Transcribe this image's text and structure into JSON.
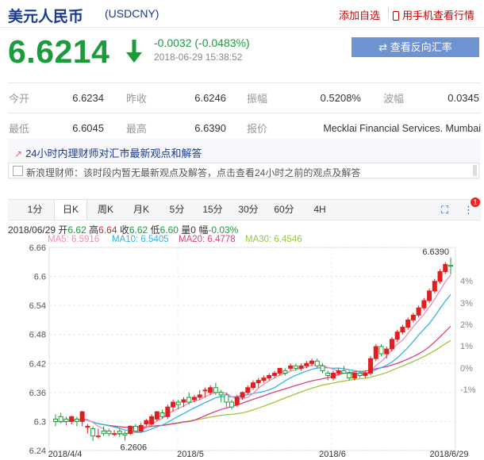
{
  "header": {
    "title": "美元人民币",
    "code": "(USDCNY)",
    "add_watch": "添加自选",
    "mobile": "用手机查看行情"
  },
  "quote": {
    "price": "6.6214",
    "change": "-0.0032 (-0.0483%)",
    "time": "2018-06-29 15:38:52",
    "reverse_button": "查看反向汇率"
  },
  "stats": [
    [
      {
        "label": "今开",
        "value": "6.6234"
      },
      {
        "label": "昨收",
        "value": "6.6246"
      },
      {
        "label": "振幅",
        "value": "0.5208%"
      },
      {
        "label": "波幅",
        "value": "0.0345"
      }
    ],
    [
      {
        "label": "最低",
        "value": "6.6045"
      },
      {
        "label": "最高",
        "value": "6.6390"
      },
      {
        "label": "报价",
        "value": "Mecklai Financial Services. Mumbai"
      }
    ]
  ],
  "news": {
    "heading": "24小时内理财师对汇市最新观点和解答",
    "message": "新浪理财师：该时段内暂无最新观点及解答，点击查看24小时之前的观点及解答"
  },
  "tabs": [
    "1分",
    "日K",
    "周K",
    "月K",
    "5分",
    "15分",
    "30分",
    "60分",
    "4H"
  ],
  "active_tab": "日K",
  "badge": "1",
  "ohlc": {
    "date": "2018/06/29",
    "open_label": "开",
    "open": "6.62",
    "high_label": "高",
    "high": "6.64",
    "close_label": "收",
    "close": "6.62",
    "low_label": "低",
    "low": "6.60",
    "volume_label": "量",
    "volume": "0",
    "amp_label": "幅",
    "amp": "-0.03%"
  },
  "ma_legend": [
    {
      "label": "MA5: 6.5916",
      "color": "#f08cb4"
    },
    {
      "label": "MA10: 6.5405",
      "color": "#32b4e6"
    },
    {
      "label": "MA20: 6.4778",
      "color": "#e0407a"
    },
    {
      "label": "MA30: 6.4546",
      "color": "#9cc83c"
    }
  ],
  "colors": {
    "up": "#e02020",
    "down": "#1a9c3a",
    "accent": "#1a3a8c"
  },
  "chart_data": {
    "type": "candlestick",
    "y_ticks": [
      "6.66",
      "6.6",
      "6.54",
      "6.48",
      "6.42",
      "6.36",
      "6.3",
      "6.24"
    ],
    "pct_ticks": [
      "4%",
      "3%",
      "2%",
      "1%",
      "0%",
      "-1%"
    ],
    "x_labels": [
      "2018/4/4",
      "2018/5",
      "2018/6",
      "2018/6/29"
    ],
    "ylim": [
      6.24,
      6.66
    ],
    "max_label": "6.6390",
    "min_label": "6.2606",
    "candles": [
      [
        6.305,
        6.31,
        6.3,
        6.315,
        6.29
      ],
      [
        6.31,
        6.305,
        6.3,
        6.318,
        6.296
      ],
      [
        6.305,
        6.3,
        6.3,
        6.31,
        6.292
      ],
      [
        6.3,
        6.305,
        6.31,
        6.312,
        6.294
      ],
      [
        6.305,
        6.3,
        6.3,
        6.31,
        6.29
      ],
      [
        6.3,
        6.295,
        6.32,
        6.322,
        6.29
      ],
      [
        6.29,
        6.285,
        6.29,
        6.295,
        6.275
      ],
      [
        6.285,
        6.27,
        6.27,
        6.29,
        6.26
      ],
      [
        6.27,
        6.28,
        6.27,
        6.285,
        6.265
      ],
      [
        6.28,
        6.285,
        6.275,
        6.29,
        6.27
      ],
      [
        6.28,
        6.275,
        6.275,
        6.285,
        6.27
      ],
      [
        6.275,
        6.28,
        6.275,
        6.282,
        6.27
      ],
      [
        6.28,
        6.275,
        6.275,
        6.285,
        6.268
      ],
      [
        6.275,
        6.27,
        6.272,
        6.28,
        6.2606
      ],
      [
        6.275,
        6.28,
        6.29,
        6.292,
        6.272
      ],
      [
        6.29,
        6.282,
        6.28,
        6.295,
        6.278
      ],
      [
        6.28,
        6.29,
        6.292,
        6.298,
        6.277
      ],
      [
        6.295,
        6.3,
        6.302,
        6.305,
        6.29
      ],
      [
        6.295,
        6.3,
        6.31,
        6.315,
        6.29
      ],
      [
        6.305,
        6.31,
        6.32,
        6.322,
        6.3
      ],
      [
        6.318,
        6.32,
        6.31,
        6.325,
        6.305
      ],
      [
        6.31,
        6.325,
        6.33,
        6.335,
        6.305
      ],
      [
        6.33,
        6.34,
        6.34,
        6.345,
        6.32
      ],
      [
        6.34,
        6.335,
        6.335,
        6.345,
        6.325
      ],
      [
        6.34,
        6.345,
        6.345,
        6.35,
        6.33
      ],
      [
        6.35,
        6.345,
        6.34,
        6.36,
        6.335
      ],
      [
        6.345,
        6.35,
        6.35,
        6.355,
        6.34
      ],
      [
        6.35,
        6.36,
        6.355,
        6.365,
        6.345
      ],
      [
        6.365,
        6.36,
        6.365,
        6.37,
        6.35
      ],
      [
        6.36,
        6.37,
        6.37,
        6.375,
        6.355
      ],
      [
        6.37,
        6.365,
        6.36,
        6.38,
        6.355
      ],
      [
        6.36,
        6.35,
        6.355,
        6.365,
        6.34
      ],
      [
        6.355,
        6.34,
        6.34,
        6.36,
        6.33
      ],
      [
        6.34,
        6.335,
        6.33,
        6.345,
        6.325
      ],
      [
        6.335,
        6.345,
        6.35,
        6.355,
        6.33
      ],
      [
        6.35,
        6.355,
        6.36,
        6.362,
        6.345
      ],
      [
        6.36,
        6.37,
        6.37,
        6.375,
        6.355
      ],
      [
        6.37,
        6.375,
        6.38,
        6.385,
        6.365
      ],
      [
        6.38,
        6.385,
        6.385,
        6.39,
        6.37
      ],
      [
        6.385,
        6.39,
        6.39,
        6.395,
        6.38
      ],
      [
        6.39,
        6.395,
        6.395,
        6.4,
        6.385
      ],
      [
        6.395,
        6.4,
        6.4,
        6.405,
        6.39
      ],
      [
        6.4,
        6.405,
        6.41,
        6.41,
        6.395
      ],
      [
        6.405,
        6.4,
        6.4,
        6.41,
        6.395
      ],
      [
        6.41,
        6.415,
        6.415,
        6.42,
        6.405
      ],
      [
        6.415,
        6.42,
        6.41,
        6.42,
        6.405
      ],
      [
        6.41,
        6.415,
        6.415,
        6.42,
        6.405
      ],
      [
        6.415,
        6.42,
        6.42,
        6.425,
        6.41
      ],
      [
        6.42,
        6.425,
        6.425,
        6.43,
        6.415
      ],
      [
        6.425,
        6.42,
        6.415,
        6.43,
        6.41
      ],
      [
        6.415,
        6.41,
        6.405,
        6.42,
        6.4
      ],
      [
        6.4,
        6.39,
        6.395,
        6.405,
        6.385
      ],
      [
        6.39,
        6.4,
        6.4,
        6.405,
        6.385
      ],
      [
        6.4,
        6.405,
        6.405,
        6.41,
        6.395
      ],
      [
        6.405,
        6.41,
        6.4,
        6.415,
        6.4
      ],
      [
        6.4,
        6.395,
        6.39,
        6.405,
        6.385
      ],
      [
        6.39,
        6.395,
        6.4,
        6.4,
        6.385
      ],
      [
        6.4,
        6.395,
        6.395,
        6.405,
        6.39
      ],
      [
        6.395,
        6.4,
        6.4,
        6.405,
        6.39
      ],
      [
        6.4,
        6.405,
        6.43,
        6.435,
        6.395
      ],
      [
        6.43,
        6.44,
        6.455,
        6.46,
        6.425
      ],
      [
        6.455,
        6.44,
        6.44,
        6.46,
        6.435
      ],
      [
        6.44,
        6.445,
        6.45,
        6.455,
        6.43
      ],
      [
        6.45,
        6.455,
        6.47,
        6.475,
        6.445
      ],
      [
        6.47,
        6.48,
        6.485,
        6.49,
        6.465
      ],
      [
        6.485,
        6.49,
        6.495,
        6.5,
        6.48
      ],
      [
        6.495,
        6.5,
        6.51,
        6.515,
        6.49
      ],
      [
        6.51,
        6.515,
        6.52,
        6.525,
        6.505
      ],
      [
        6.52,
        6.53,
        6.535,
        6.54,
        6.515
      ],
      [
        6.535,
        6.545,
        6.55,
        6.555,
        6.53
      ],
      [
        6.55,
        6.56,
        6.57,
        6.575,
        6.545
      ],
      [
        6.57,
        6.585,
        6.59,
        6.595,
        6.565
      ],
      [
        6.59,
        6.6,
        6.61,
        6.615,
        6.585
      ],
      [
        6.61,
        6.62,
        6.625,
        6.63,
        6.605
      ],
      [
        6.623,
        6.62,
        6.621,
        6.639,
        6.6045
      ]
    ]
  }
}
